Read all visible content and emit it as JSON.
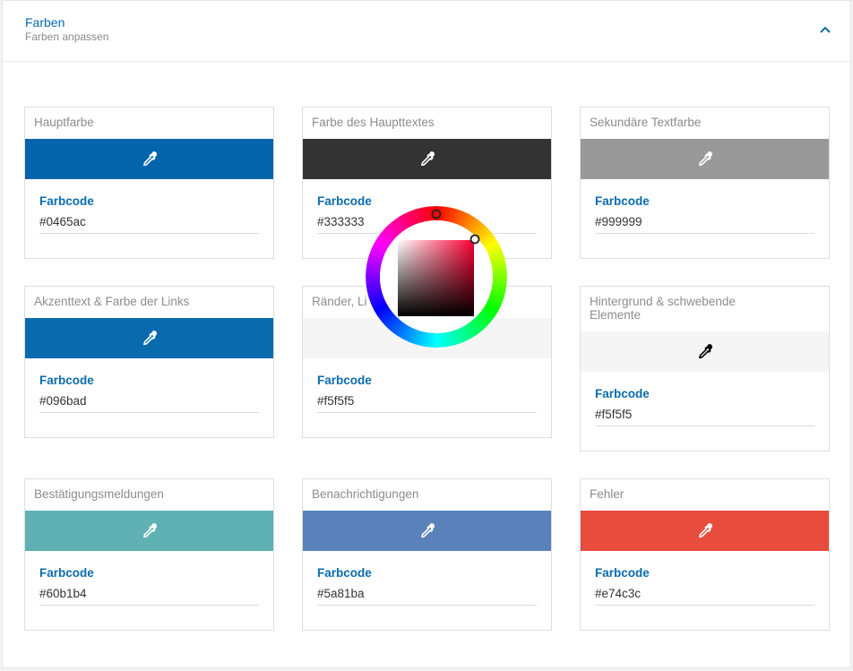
{
  "header": {
    "title": "Farben",
    "subtitle": "Farben anpassen",
    "collapse_icon": "chevron-up-icon",
    "accent": "#0a6bad"
  },
  "cards": [
    {
      "title": "Hauptfarbe",
      "field_label": "Farbcode",
      "value": "#0465ac",
      "swatch": "#0465ac",
      "icon": "eyedropper-icon",
      "icon_color": "#ffffff"
    },
    {
      "title": "Farbe des Haupttextes",
      "field_label": "Farbcode",
      "value": "#333333",
      "swatch": "#333333",
      "icon": "eyedropper-icon",
      "icon_color": "#ffffff"
    },
    {
      "title": "Sekundäre Textfarbe",
      "field_label": "Farbcode",
      "value": "#999999",
      "swatch": "#999999",
      "icon": "eyedropper-icon",
      "icon_color": "#ffffff"
    },
    {
      "title": "Akzenttext & Farbe der Links",
      "field_label": "Farbcode",
      "value": "#096bad",
      "swatch": "#096bad",
      "icon": "eyedropper-icon",
      "icon_color": "#ffffff"
    },
    {
      "title": "Ränder, Li",
      "field_label": "Farbcode",
      "value": "#f5f5f5",
      "swatch": "#f5f5f5",
      "icon": "eyedropper-icon",
      "icon_color": "#000000"
    },
    {
      "title": "Hintergrund & schwebende Elemente",
      "field_label": "Farbcode",
      "value": "#f5f5f5",
      "swatch": "#f5f5f5",
      "icon": "eyedropper-icon",
      "icon_color": "#000000"
    },
    {
      "title": "Bestätigungsmeldungen",
      "field_label": "Farbcode",
      "value": "#60b1b4",
      "swatch": "#60b1b4",
      "icon": "eyedropper-icon",
      "icon_color": "#ffffff"
    },
    {
      "title": "Benachrichtigungen",
      "field_label": "Farbcode",
      "value": "#5a81ba",
      "swatch": "#5a81ba",
      "icon": "eyedropper-icon",
      "icon_color": "#ffffff"
    },
    {
      "title": "Fehler",
      "field_label": "Farbcode",
      "value": "#e74c3c",
      "swatch": "#e74c3c",
      "icon": "eyedropper-icon",
      "icon_color": "#ffffff"
    }
  ],
  "color_picker": {
    "open": true,
    "wheel_icon": "hue-ring",
    "selected_hue_color": "#ff0033"
  }
}
